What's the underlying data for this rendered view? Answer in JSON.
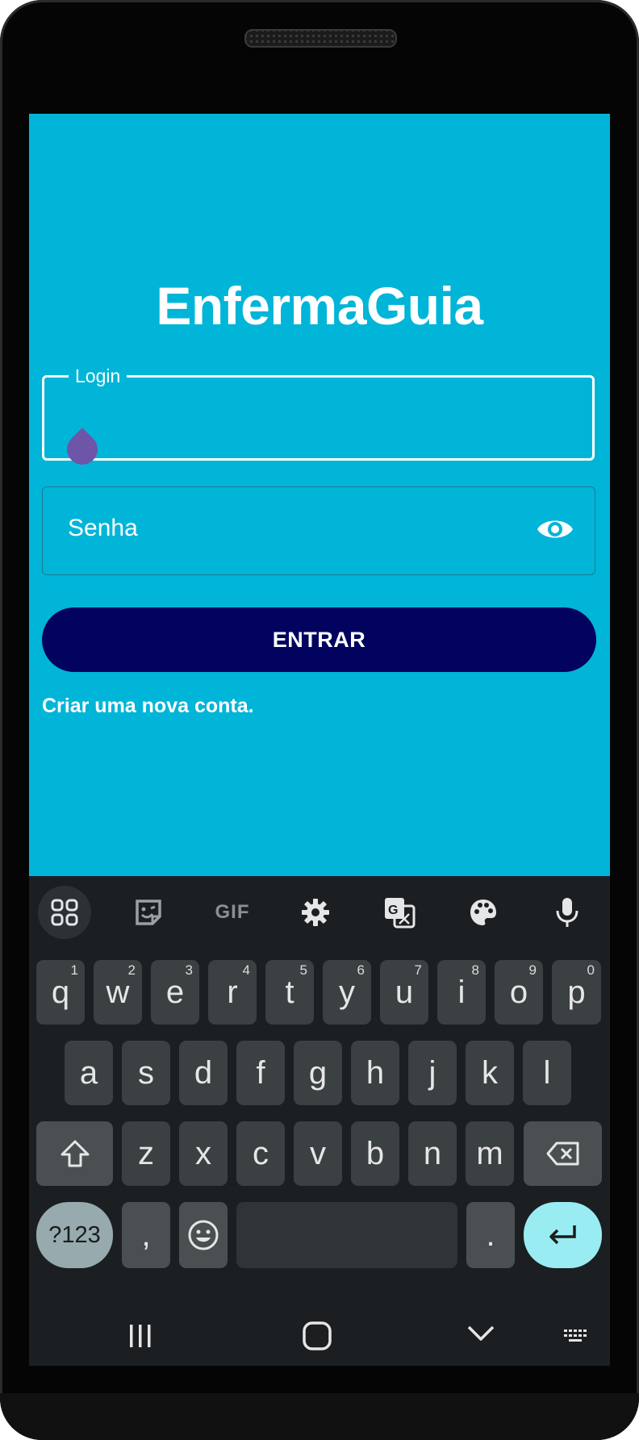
{
  "app": {
    "title": "EnfermaGuia",
    "login_label": "Login",
    "password_placeholder": "Senha",
    "submit_label": "ENTRAR",
    "create_account_label": "Criar uma nova conta."
  },
  "colors": {
    "background": "#00B5D8",
    "button": "#02035E",
    "cursor_handle": "#6D55A8",
    "keyboard_background": "#1B1F21",
    "enter_key": "#9AECF3"
  },
  "keyboard": {
    "toolbar_icons": [
      "apps-grid-icon",
      "sticker-icon",
      "gif-icon",
      "settings-icon",
      "translate-icon",
      "palette-icon",
      "microphone-icon"
    ],
    "gif_label": "GIF",
    "row1": [
      {
        "key": "q",
        "hint": "1"
      },
      {
        "key": "w",
        "hint": "2"
      },
      {
        "key": "e",
        "hint": "3"
      },
      {
        "key": "r",
        "hint": "4"
      },
      {
        "key": "t",
        "hint": "5"
      },
      {
        "key": "y",
        "hint": "6"
      },
      {
        "key": "u",
        "hint": "7"
      },
      {
        "key": "i",
        "hint": "8"
      },
      {
        "key": "o",
        "hint": "9"
      },
      {
        "key": "p",
        "hint": "0"
      }
    ],
    "row2": [
      "a",
      "s",
      "d",
      "f",
      "g",
      "h",
      "j",
      "k",
      "l"
    ],
    "row3": [
      "z",
      "x",
      "c",
      "v",
      "b",
      "n",
      "m"
    ],
    "symbols_label": "?123",
    "comma_label": ",",
    "period_label": "."
  },
  "navbar": {
    "icons": [
      "recent-apps-icon",
      "home-icon",
      "hide-keyboard-icon",
      "keyboard-switch-icon"
    ]
  }
}
